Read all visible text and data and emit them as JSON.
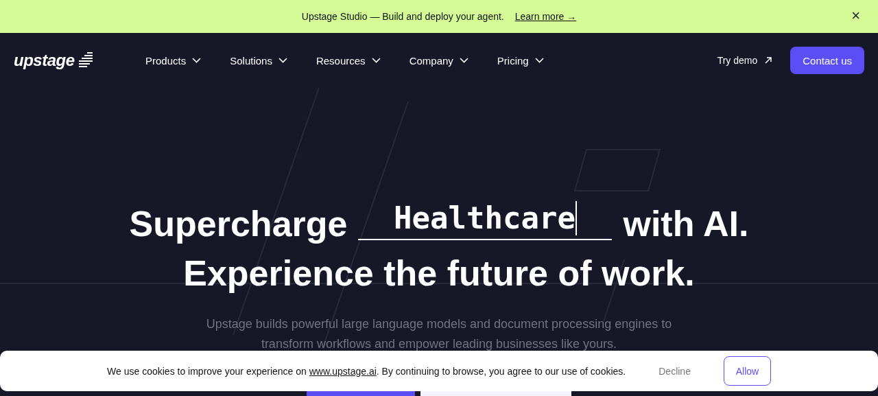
{
  "announcement": {
    "text": "Upstage Studio — Build and deploy your agent.",
    "link": "Learn more →",
    "close": "×"
  },
  "nav": {
    "logo": "upstage",
    "items": [
      {
        "label": "Products",
        "dropdown": true
      },
      {
        "label": "Solutions",
        "dropdown": true
      },
      {
        "label": "Resources",
        "dropdown": true
      },
      {
        "label": "Company",
        "dropdown": true
      },
      {
        "label": "Pricing",
        "dropdown": true
      }
    ],
    "try_demo": "Try demo",
    "contact": "Contact us"
  },
  "hero": {
    "prefix": "Supercharge",
    "typed_word": "Healthcare",
    "suffix": "with AI.",
    "line2": "Experience the future of work.",
    "description": "Upstage builds powerful large language models and document processing engines to transform workflows and empower leading businesses like yours."
  },
  "cookie_banner": {
    "text_before": "We use cookies to improve your experience on ",
    "link": "www.upstage.ai",
    "text_after": ". By continuing to browse, you agree to our use of cookies.",
    "decline": "Decline",
    "allow": "Allow"
  }
}
